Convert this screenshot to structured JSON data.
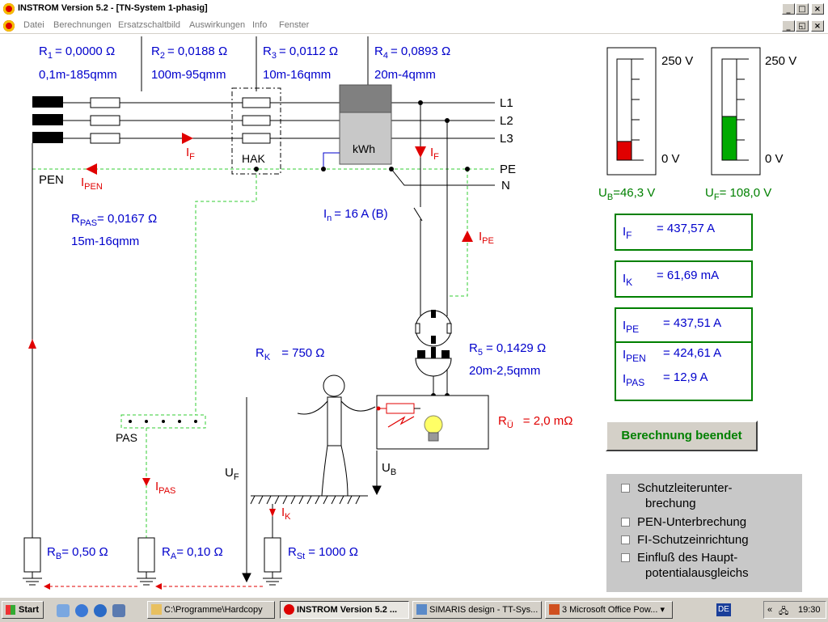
{
  "window": {
    "title": "INSTROM Version 5.2 - [TN-System 1-phasig]",
    "menu": [
      "Datei",
      "Berechnungen",
      "Ersatzschaltbild",
      "Auswirkungen",
      "Info",
      "Fenster"
    ]
  },
  "resistors": {
    "r1": {
      "name": "R",
      "sub": "1",
      "value": "= 0,0000 Ω",
      "desc": "0,1m-185qmm"
    },
    "r2": {
      "name": "R",
      "sub": "2",
      "value": "= 0,0188 Ω",
      "desc": "100m-95qmm"
    },
    "r3": {
      "name": "R",
      "sub": "3",
      "value": "= 0,0112 Ω",
      "desc": "10m-16qmm"
    },
    "r4": {
      "name": "R",
      "sub": "4",
      "value": "= 0,0893 Ω",
      "desc": "20m-4qmm"
    },
    "r5": {
      "name": "R",
      "sub": "5",
      "value": "= 0,1429 Ω",
      "desc": "20m-2,5qmm"
    },
    "rpas": {
      "name": "R",
      "sub": "PAS",
      "value": "= 0,0167 Ω",
      "desc": "15m-16qmm"
    },
    "rk": {
      "name": "R",
      "sub": "K",
      "value": "= 750 Ω"
    },
    "rue": {
      "name": "R",
      "sub": "Ü",
      "value": "= 2,0 mΩ"
    },
    "rb": {
      "name": "R",
      "sub": "B",
      "value": "= 0,50 Ω"
    },
    "ra": {
      "name": "R",
      "sub": "A",
      "value": "= 0,10 Ω"
    },
    "rst": {
      "name": "R",
      "sub": "St",
      "value": "= 1000 Ω"
    }
  },
  "diagram": {
    "lines": [
      "L1",
      "L2",
      "L3",
      "PE",
      "N"
    ],
    "pen": "PEN",
    "hak": "HAK",
    "meter": "kWh",
    "pas": "PAS",
    "breaker": {
      "name": "I",
      "sub": "n",
      "value": "= 16 A (B)"
    },
    "currents": {
      "if": "F",
      "ipen": "PEN",
      "ipe": "PE",
      "ipas": "PAS",
      "ik": "K"
    },
    "voltages": {
      "uf": "F",
      "ub": "B"
    }
  },
  "gauges": {
    "ub": {
      "max": "250 V",
      "min": "0 V",
      "label_sub": "B",
      "value": "=46,3 V",
      "fill_pct": 18.5,
      "color": "#e00000"
    },
    "uf": {
      "max": "250 V",
      "min": "0 V",
      "label_sub": "F",
      "value": "= 108,0 V",
      "fill_pct": 43.2,
      "color": "#00aa00"
    }
  },
  "results": {
    "if": {
      "sub": "F",
      "value": "= 437,57 A"
    },
    "ik": {
      "sub": "K",
      "value": "= 61,69 mA"
    },
    "ipe": {
      "sub": "PE",
      "value": "= 437,51 A"
    },
    "ipen": {
      "sub": "PEN",
      "value": "= 424,61 A"
    },
    "ipas": {
      "sub": "PAS",
      "value": "= 12,9 A"
    }
  },
  "calc_button": "Berechnung beendet",
  "options": [
    {
      "label": "Schutzleiterunter-",
      "label2": "brechung",
      "checked": false
    },
    {
      "label": "PEN-Unterbrechung",
      "checked": false
    },
    {
      "label": "FI-Schutzeinrichtung",
      "checked": false
    },
    {
      "label": "Einfluß des Haupt-",
      "label2": "potentialausgleichs",
      "checked": false
    }
  ],
  "taskbar": {
    "start": "Start",
    "tasks": [
      "C:\\Programme\\Hardcopy",
      "INSTROM Version 5.2 ...",
      "SIMARIS design - TT-Sys...",
      "3 Microsoft Office Pow..."
    ],
    "lang": "DE",
    "clock": "19:30"
  }
}
